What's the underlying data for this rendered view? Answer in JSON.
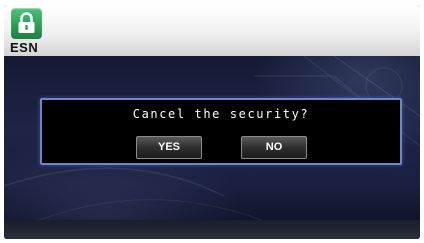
{
  "header": {
    "icon": "lock-icon",
    "icon_color": "#2b9a54",
    "label": "ESN"
  },
  "dialog": {
    "message": "Cancel the security?",
    "buttons": {
      "yes_label": "YES",
      "no_label": "NO"
    },
    "border_color": "#6f86c9"
  }
}
